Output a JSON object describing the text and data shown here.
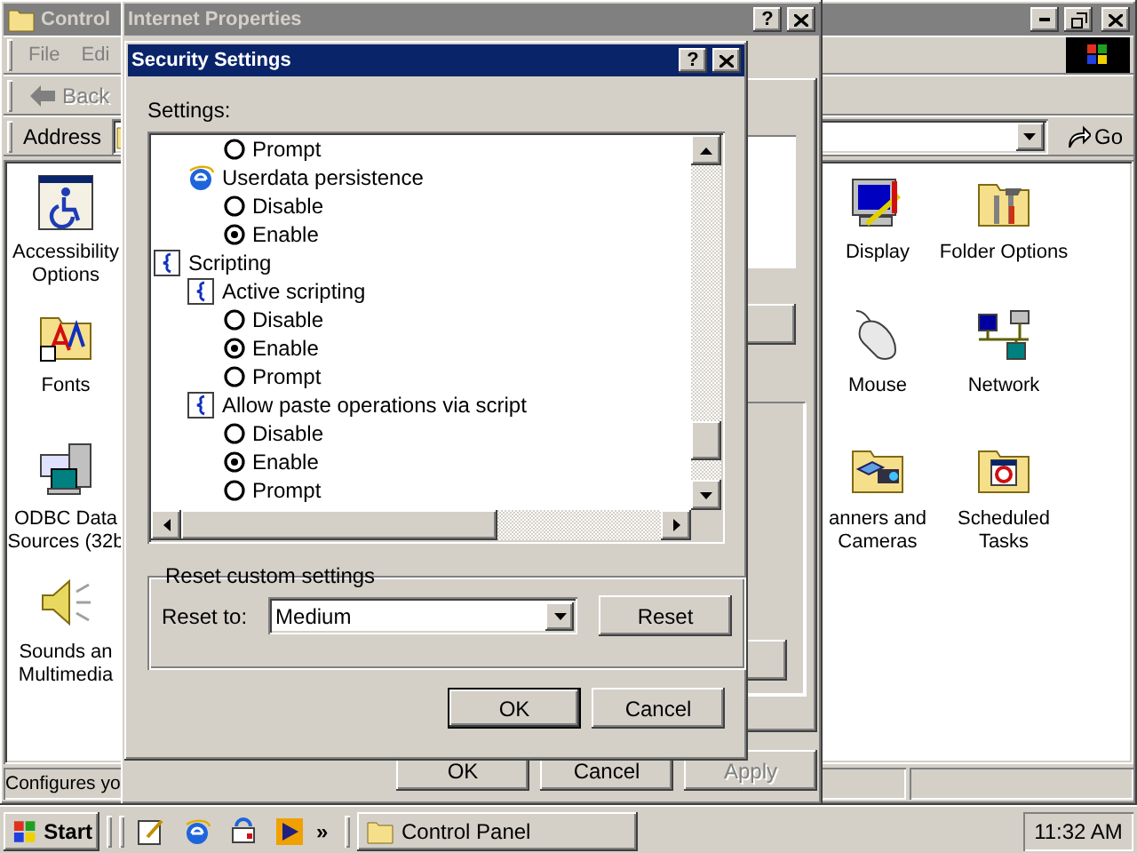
{
  "control_panel": {
    "title": "Control",
    "menu": [
      "File",
      "Edi"
    ],
    "back": {
      "label": "Back",
      "disabled": true
    },
    "address_label": "Address",
    "go": "Go",
    "left_items": [
      {
        "kind": "accessibility",
        "lines": [
          "Accessibility",
          "Options"
        ]
      },
      {
        "kind": "fonts",
        "lines": [
          "Fonts"
        ]
      },
      {
        "kind": "odbc",
        "lines": [
          "ODBC Data",
          "Sources (32b"
        ]
      },
      {
        "kind": "sounds",
        "lines": [
          "Sounds an",
          "Multimedia"
        ]
      }
    ],
    "right_items": [
      {
        "kind": "display",
        "lines": [
          "Display"
        ]
      },
      {
        "kind": "folder-options",
        "lines": [
          "Folder Options"
        ]
      },
      {
        "kind": "mouse",
        "lines": [
          "Mouse"
        ]
      },
      {
        "kind": "network",
        "lines": [
          "Network"
        ]
      },
      {
        "kind": "scanners",
        "lines": [
          "anners and",
          "Cameras"
        ]
      },
      {
        "kind": "tasks",
        "lines": [
          "Scheduled",
          "Tasks"
        ]
      }
    ],
    "status": "Configures yo"
  },
  "internet_properties": {
    "title": "Internet Properties",
    "help": "?",
    "buttons": [
      {
        "label": "OK",
        "disabled": false
      },
      {
        "label": "Cancel",
        "disabled": false
      },
      {
        "label": "Apply",
        "disabled": true
      }
    ]
  },
  "security_settings": {
    "title": "Security Settings",
    "help": "?",
    "settings_label": "Settings:",
    "tree": [
      {
        "kind": "group",
        "children": [
          {
            "kind": "group",
            "children": [
              {
                "kind": "option",
                "label": "Prompt",
                "selected": false
              }
            ]
          },
          {
            "kind": "web-setting",
            "label": "Userdata persistence",
            "children": [
              {
                "kind": "option",
                "label": "Disable",
                "selected": false
              },
              {
                "kind": "option",
                "label": "Enable",
                "selected": true
              }
            ]
          }
        ]
      },
      {
        "kind": "script-setting",
        "label": "Scripting",
        "children": [
          {
            "kind": "script-setting",
            "label": "Active scripting",
            "children": [
              {
                "kind": "option",
                "label": "Disable",
                "selected": false
              },
              {
                "kind": "option",
                "label": "Enable",
                "selected": true
              },
              {
                "kind": "option",
                "label": "Prompt",
                "selected": false
              }
            ]
          },
          {
            "kind": "script-setting",
            "label": "Allow paste operations via script",
            "children": [
              {
                "kind": "option",
                "label": "Disable",
                "selected": false
              },
              {
                "kind": "option",
                "label": "Enable",
                "selected": true
              },
              {
                "kind": "option",
                "label": "Prompt",
                "selected": false
              }
            ]
          }
        ]
      }
    ],
    "reset_group": {
      "title": "Reset custom settings",
      "label": "Reset to:",
      "value": "Medium",
      "button": "Reset"
    },
    "buttons": [
      {
        "label": "OK",
        "default": true
      },
      {
        "label": "Cancel",
        "default": false
      }
    ]
  },
  "taskbar": {
    "start": "Start",
    "quick_launch": [
      {
        "kind": "notepad"
      },
      {
        "kind": "ie"
      },
      {
        "kind": "sync"
      },
      {
        "kind": "media"
      }
    ],
    "more": "»",
    "tasks": [
      {
        "label": "Control Panel",
        "selected": false
      }
    ],
    "clock": "11:32 AM"
  }
}
